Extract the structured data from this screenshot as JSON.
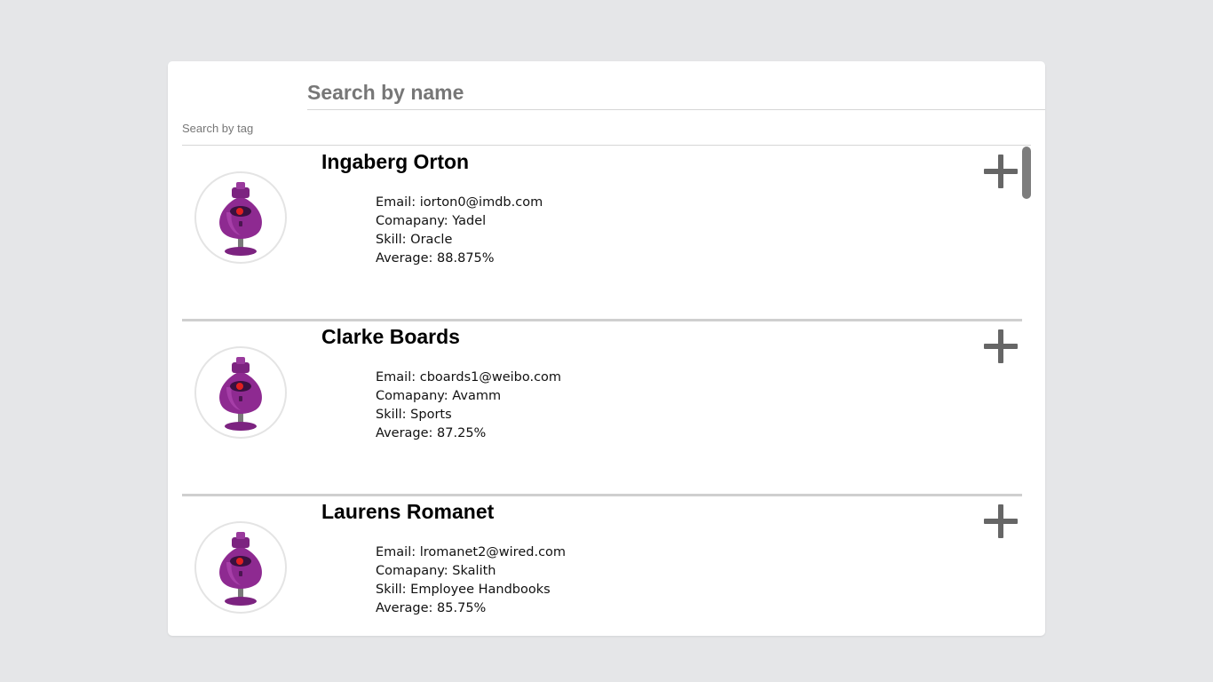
{
  "search": {
    "name_placeholder": "Search by name",
    "tag_placeholder": "Search by tag"
  },
  "students": [
    {
      "name": "Ingaberg Orton",
      "email": "Email: iorton0@imdb.com",
      "company": "Comapany: Yadel",
      "skill": "Skill: Oracle",
      "average": "Average: 88.875%"
    },
    {
      "name": "Clarke Boards",
      "email": "Email: cboards1@weibo.com",
      "company": "Comapany: Avamm",
      "skill": "Skill: Sports",
      "average": "Average: 87.25%"
    },
    {
      "name": "Laurens Romanet",
      "email": "Email: lromanet2@wired.com",
      "company": "Comapany: Skalith",
      "skill": "Skill: Employee Handbooks",
      "average": "Average: 85.75%"
    }
  ],
  "icons": {
    "expand": "plus-icon",
    "avatar": "robot-avatar-icon"
  },
  "colors": {
    "background": "#e5e6e8",
    "card": "#ffffff",
    "icon": "#666666",
    "avatar_body": "#8e2a91"
  }
}
